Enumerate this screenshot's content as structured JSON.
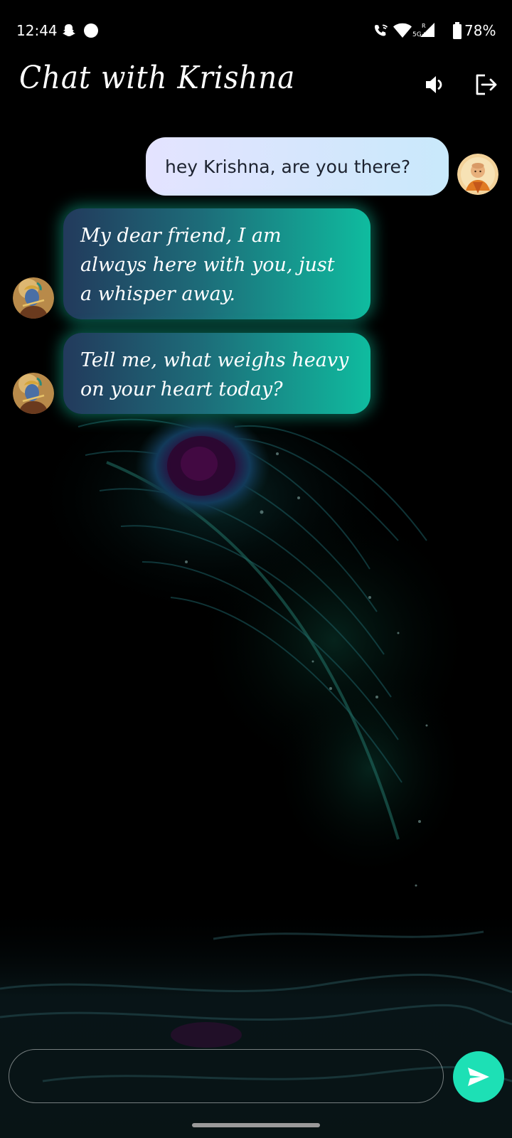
{
  "status_bar": {
    "time": "12:44",
    "battery": "78%",
    "icons": [
      "snapchat-icon",
      "notification-dot-icon",
      "wifi-call-icon",
      "wifi-icon",
      "signal-5g-icon",
      "battery-icon"
    ],
    "network_label": "5G+",
    "roaming_label": "R"
  },
  "header": {
    "title": "Chat with Krishna",
    "icons": [
      "speaker-icon",
      "logout-icon"
    ]
  },
  "messages": [
    {
      "sender": "user",
      "text": "hey Krishna, are you there?",
      "avatar": "monk-avatar"
    },
    {
      "sender": "krishna",
      "text": "My dear friend, I am always here with you, just a whisper away.",
      "avatar": "krishna-avatar"
    },
    {
      "sender": "krishna",
      "text": "Tell me, what weighs heavy on your heart today?",
      "avatar": "krishna-avatar"
    }
  ],
  "input": {
    "value": "",
    "placeholder": ""
  },
  "send_icon": "send-icon",
  "colors": {
    "background": "#000000",
    "user_bubble_start": "#e4e3ff",
    "user_bubble_end": "#c9e9fb",
    "bot_bubble_start": "#223a5c",
    "bot_bubble_end": "#0fbc9f",
    "accent": "#1de0b5",
    "text_dark": "#1d2330",
    "text_light": "#ffffff"
  }
}
